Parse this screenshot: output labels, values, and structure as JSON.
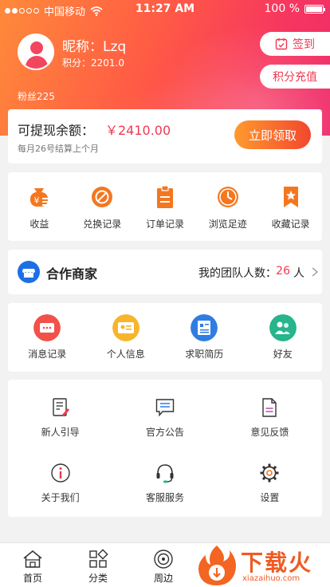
{
  "status_bar": {
    "carrier": "中国移动",
    "time": "11:27 AM",
    "battery": "100 %"
  },
  "profile": {
    "nickname": "昵称：Lzq",
    "points": "积分：2201.0",
    "fans": "粉丝225",
    "signin_label": "签到",
    "recharge_label": "积分充值"
  },
  "balance": {
    "label": "可提现余额：",
    "amount": "￥2410.00",
    "note": "每月26号结算上个月",
    "claim_label": "立即领取"
  },
  "quick_items": [
    {
      "icon": "wallet-icon",
      "label": "收益"
    },
    {
      "icon": "exchange-icon",
      "label": "兑换记录"
    },
    {
      "icon": "clipboard-icon",
      "label": "订单记录"
    },
    {
      "icon": "clock-icon",
      "label": "浏览足迹"
    },
    {
      "icon": "bookmark-star-icon",
      "label": "收藏记录"
    }
  ],
  "partner": {
    "title": "合作商家",
    "team_label": "我的团队人数：",
    "team_count": "26",
    "team_unit": "人"
  },
  "circle_items": [
    {
      "icon": "message-icon",
      "label": "消息记录",
      "color": "#f2514a"
    },
    {
      "icon": "id-card-icon",
      "label": "个人信息",
      "color": "#f7b52c"
    },
    {
      "icon": "resume-icon",
      "label": "求职简历",
      "color": "#2f7de1"
    },
    {
      "icon": "friends-icon",
      "label": "好友",
      "color": "#26b58c"
    }
  ],
  "grid_items": [
    {
      "icon": "guide-icon",
      "label": "新人引导"
    },
    {
      "icon": "announcement-icon",
      "label": "官方公告"
    },
    {
      "icon": "feedback-icon",
      "label": "意见反馈"
    },
    {
      "icon": "info-icon",
      "label": "关于我们"
    },
    {
      "icon": "headset-icon",
      "label": "客服服务"
    },
    {
      "icon": "gear-icon",
      "label": "设置"
    }
  ],
  "tabbar": [
    {
      "icon": "home-icon",
      "label": "首页"
    },
    {
      "icon": "category-icon",
      "label": "分类"
    },
    {
      "icon": "location-icon",
      "label": "周边"
    }
  ],
  "watermark": {
    "title": "下载火",
    "subtitle": "xiazaihuo.com"
  },
  "colors": {
    "accent": "#f0384f",
    "orange": "#f4771f",
    "header_start": "#ff8a3a",
    "header_end": "#ee2a6b"
  }
}
